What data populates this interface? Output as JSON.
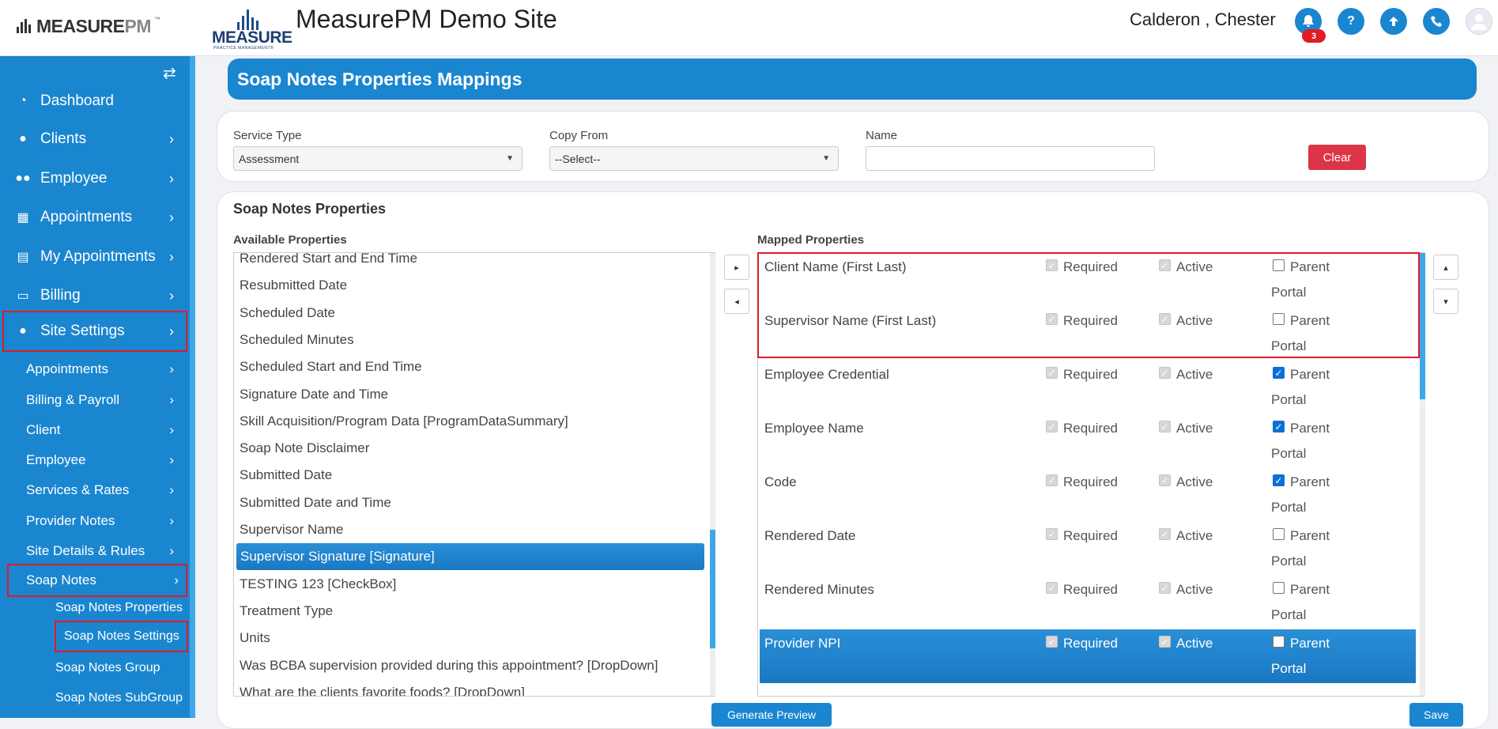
{
  "header": {
    "brand": "MEASURE",
    "brand_suffix": "PM",
    "brand_tm": "™",
    "logo_word": "MEASURE",
    "logo_sub": "PRACTICE MANAGEMENT®",
    "site_title": "MeasurePM Demo Site",
    "user_name": "Calderon , Chester",
    "notification_count": "3",
    "icons": [
      "bell-icon",
      "help-icon",
      "upload-icon",
      "phone-icon",
      "avatar-icon"
    ]
  },
  "sidebar": {
    "main": [
      {
        "label": "Dashboard",
        "icon": "dashboard-icon"
      },
      {
        "label": "Clients",
        "icon": "user-icon"
      },
      {
        "label": "Employee",
        "icon": "users-icon"
      },
      {
        "label": "Appointments",
        "icon": "calendar-icon"
      },
      {
        "label": "My Appointments",
        "icon": "book-icon"
      },
      {
        "label": "Billing",
        "icon": "money-icon"
      },
      {
        "label": "Site Settings",
        "icon": "user-icon"
      }
    ],
    "sub": [
      "Appointments",
      "Billing & Payroll",
      "Client",
      "Employee",
      "Services & Rates",
      "Provider Notes",
      "Site Details & Rules",
      "Soap Notes"
    ],
    "soap_sub": [
      "Soap Notes Properties",
      "Soap Notes Settings",
      "Soap Notes Group",
      "Soap Notes SubGroup"
    ]
  },
  "page": {
    "title": "Soap Notes Properties Mappings"
  },
  "filters": {
    "service_type_label": "Service Type",
    "service_type_value": "Assessment",
    "copy_from_label": "Copy From",
    "copy_from_value": "--Select--",
    "name_label": "Name",
    "name_value": "",
    "clear_label": "Clear"
  },
  "properties": {
    "title": "Soap Notes Properties",
    "available_title": "Available Properties",
    "mapped_title": "Mapped Properties",
    "available": [
      "Rendered Start and End Time",
      "Resubmitted Date",
      "Scheduled Date",
      "Scheduled Minutes",
      "Scheduled Start and End Time",
      "Signature Date and Time",
      "Skill Acquisition/Program Data [ProgramDataSummary]",
      "Soap Note Disclaimer",
      "Submitted Date",
      "Submitted Date and Time",
      "Supervisor Name",
      "Supervisor Signature [Signature]",
      "TESTING 123 [CheckBox]",
      "Treatment Type",
      "Units",
      "Was BCBA supervision provided during this appointment? [DropDown]",
      "What are the clients favorite foods? [DropDown]"
    ],
    "available_selected": "Supervisor Signature [Signature]",
    "labels": {
      "required": "Required",
      "active": "Active",
      "parent": "Parent",
      "portal": "Portal"
    },
    "mapped": [
      {
        "name": "Client Name (First Last)",
        "parent_portal": false,
        "selected": false
      },
      {
        "name": "Supervisor Name (First Last)",
        "parent_portal": false,
        "selected": false
      },
      {
        "name": "Employee Credential",
        "parent_portal": true,
        "selected": false
      },
      {
        "name": "Employee Name",
        "parent_portal": true,
        "selected": false
      },
      {
        "name": "Code",
        "parent_portal": true,
        "selected": false
      },
      {
        "name": "Rendered Date",
        "parent_portal": false,
        "selected": false
      },
      {
        "name": "Rendered Minutes",
        "parent_portal": false,
        "selected": false
      },
      {
        "name": "Provider NPI",
        "parent_portal": false,
        "selected": true
      }
    ],
    "move_right": "▸",
    "move_left": "◂",
    "move_up": "▴",
    "move_down": "▾"
  },
  "actions": {
    "generate_preview": "Generate Preview",
    "save": "Save"
  },
  "colors": {
    "primary": "#1a86d0",
    "danger": "#dc3545",
    "highlight": "#e01b24"
  }
}
